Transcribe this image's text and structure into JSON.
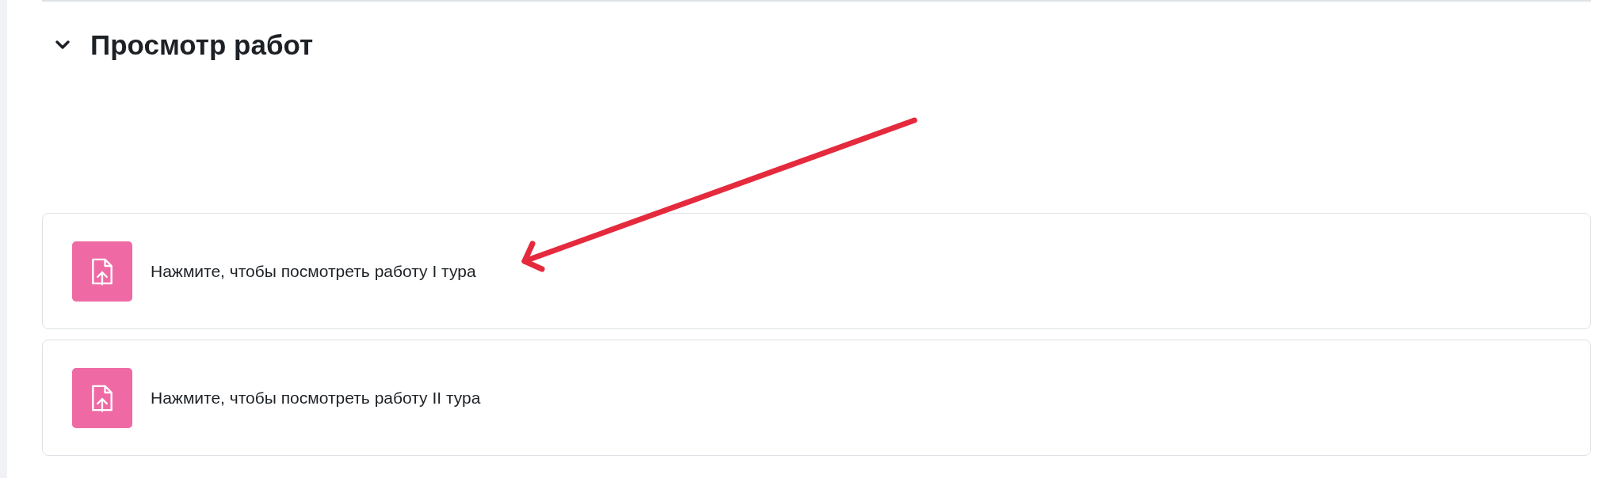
{
  "section": {
    "title": "Просмотр работ",
    "expanded": true
  },
  "activities": [
    {
      "label": "Нажмите, чтобы посмотреть работу I тура",
      "kind": "assignment"
    },
    {
      "label": "Нажмите, чтобы посмотреть работу II тура",
      "kind": "assignment"
    }
  ],
  "annotation": {
    "kind": "arrow",
    "color": "#e52a3d"
  }
}
